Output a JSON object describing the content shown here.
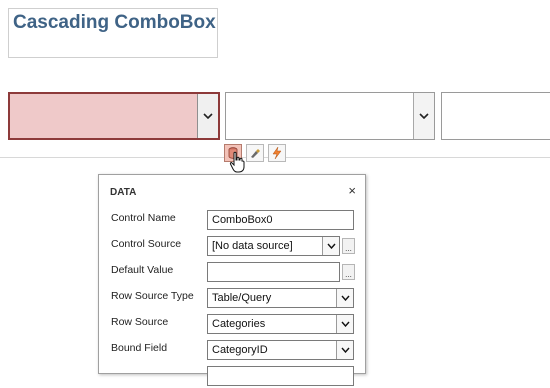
{
  "form": {
    "title": "Cascading ComboBox"
  },
  "combos": [
    {
      "state": "selected"
    },
    {
      "state": "normal"
    },
    {
      "state": "normal"
    }
  ],
  "icons": {
    "dropdown": "chevron-down-icon",
    "data_tab": "data-icon",
    "format_tab": "brush-icon",
    "event_tab": "lightning-icon"
  },
  "property_sheet": {
    "header": "DATA",
    "close_label": "×",
    "builder_label": "...",
    "rows": [
      {
        "label": "Control Name",
        "value": "ComboBox0"
      },
      {
        "label": "Control Source",
        "value": "[No data source]"
      },
      {
        "label": "Default Value",
        "value": ""
      },
      {
        "label": "Row Source Type",
        "value": "Table/Query"
      },
      {
        "label": "Row Source",
        "value": "Categories"
      },
      {
        "label": "Bound Field",
        "value": "CategoryID"
      }
    ]
  },
  "colors": {
    "title": "#3f6386",
    "selected_fill": "#efc9c9",
    "selected_border": "#8d3a3a"
  }
}
